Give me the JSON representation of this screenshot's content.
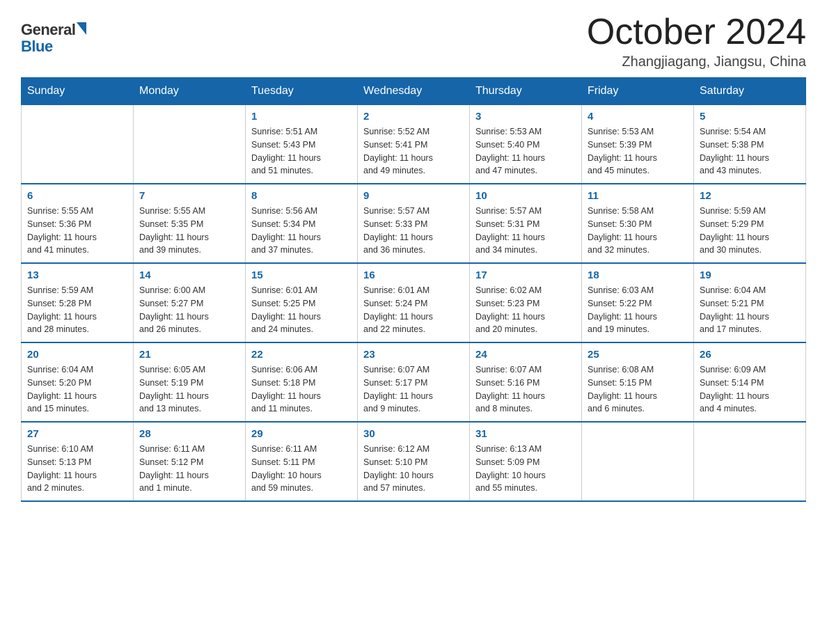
{
  "logo": {
    "general": "General",
    "blue": "Blue"
  },
  "title": {
    "month_year": "October 2024",
    "location": "Zhangjiagang, Jiangsu, China"
  },
  "weekdays": [
    "Sunday",
    "Monday",
    "Tuesday",
    "Wednesday",
    "Thursday",
    "Friday",
    "Saturday"
  ],
  "weeks": [
    [
      {
        "day": "",
        "info": ""
      },
      {
        "day": "",
        "info": ""
      },
      {
        "day": "1",
        "info": "Sunrise: 5:51 AM\nSunset: 5:43 PM\nDaylight: 11 hours\nand 51 minutes."
      },
      {
        "day": "2",
        "info": "Sunrise: 5:52 AM\nSunset: 5:41 PM\nDaylight: 11 hours\nand 49 minutes."
      },
      {
        "day": "3",
        "info": "Sunrise: 5:53 AM\nSunset: 5:40 PM\nDaylight: 11 hours\nand 47 minutes."
      },
      {
        "day": "4",
        "info": "Sunrise: 5:53 AM\nSunset: 5:39 PM\nDaylight: 11 hours\nand 45 minutes."
      },
      {
        "day": "5",
        "info": "Sunrise: 5:54 AM\nSunset: 5:38 PM\nDaylight: 11 hours\nand 43 minutes."
      }
    ],
    [
      {
        "day": "6",
        "info": "Sunrise: 5:55 AM\nSunset: 5:36 PM\nDaylight: 11 hours\nand 41 minutes."
      },
      {
        "day": "7",
        "info": "Sunrise: 5:55 AM\nSunset: 5:35 PM\nDaylight: 11 hours\nand 39 minutes."
      },
      {
        "day": "8",
        "info": "Sunrise: 5:56 AM\nSunset: 5:34 PM\nDaylight: 11 hours\nand 37 minutes."
      },
      {
        "day": "9",
        "info": "Sunrise: 5:57 AM\nSunset: 5:33 PM\nDaylight: 11 hours\nand 36 minutes."
      },
      {
        "day": "10",
        "info": "Sunrise: 5:57 AM\nSunset: 5:31 PM\nDaylight: 11 hours\nand 34 minutes."
      },
      {
        "day": "11",
        "info": "Sunrise: 5:58 AM\nSunset: 5:30 PM\nDaylight: 11 hours\nand 32 minutes."
      },
      {
        "day": "12",
        "info": "Sunrise: 5:59 AM\nSunset: 5:29 PM\nDaylight: 11 hours\nand 30 minutes."
      }
    ],
    [
      {
        "day": "13",
        "info": "Sunrise: 5:59 AM\nSunset: 5:28 PM\nDaylight: 11 hours\nand 28 minutes."
      },
      {
        "day": "14",
        "info": "Sunrise: 6:00 AM\nSunset: 5:27 PM\nDaylight: 11 hours\nand 26 minutes."
      },
      {
        "day": "15",
        "info": "Sunrise: 6:01 AM\nSunset: 5:25 PM\nDaylight: 11 hours\nand 24 minutes."
      },
      {
        "day": "16",
        "info": "Sunrise: 6:01 AM\nSunset: 5:24 PM\nDaylight: 11 hours\nand 22 minutes."
      },
      {
        "day": "17",
        "info": "Sunrise: 6:02 AM\nSunset: 5:23 PM\nDaylight: 11 hours\nand 20 minutes."
      },
      {
        "day": "18",
        "info": "Sunrise: 6:03 AM\nSunset: 5:22 PM\nDaylight: 11 hours\nand 19 minutes."
      },
      {
        "day": "19",
        "info": "Sunrise: 6:04 AM\nSunset: 5:21 PM\nDaylight: 11 hours\nand 17 minutes."
      }
    ],
    [
      {
        "day": "20",
        "info": "Sunrise: 6:04 AM\nSunset: 5:20 PM\nDaylight: 11 hours\nand 15 minutes."
      },
      {
        "day": "21",
        "info": "Sunrise: 6:05 AM\nSunset: 5:19 PM\nDaylight: 11 hours\nand 13 minutes."
      },
      {
        "day": "22",
        "info": "Sunrise: 6:06 AM\nSunset: 5:18 PM\nDaylight: 11 hours\nand 11 minutes."
      },
      {
        "day": "23",
        "info": "Sunrise: 6:07 AM\nSunset: 5:17 PM\nDaylight: 11 hours\nand 9 minutes."
      },
      {
        "day": "24",
        "info": "Sunrise: 6:07 AM\nSunset: 5:16 PM\nDaylight: 11 hours\nand 8 minutes."
      },
      {
        "day": "25",
        "info": "Sunrise: 6:08 AM\nSunset: 5:15 PM\nDaylight: 11 hours\nand 6 minutes."
      },
      {
        "day": "26",
        "info": "Sunrise: 6:09 AM\nSunset: 5:14 PM\nDaylight: 11 hours\nand 4 minutes."
      }
    ],
    [
      {
        "day": "27",
        "info": "Sunrise: 6:10 AM\nSunset: 5:13 PM\nDaylight: 11 hours\nand 2 minutes."
      },
      {
        "day": "28",
        "info": "Sunrise: 6:11 AM\nSunset: 5:12 PM\nDaylight: 11 hours\nand 1 minute."
      },
      {
        "day": "29",
        "info": "Sunrise: 6:11 AM\nSunset: 5:11 PM\nDaylight: 10 hours\nand 59 minutes."
      },
      {
        "day": "30",
        "info": "Sunrise: 6:12 AM\nSunset: 5:10 PM\nDaylight: 10 hours\nand 57 minutes."
      },
      {
        "day": "31",
        "info": "Sunrise: 6:13 AM\nSunset: 5:09 PM\nDaylight: 10 hours\nand 55 minutes."
      },
      {
        "day": "",
        "info": ""
      },
      {
        "day": "",
        "info": ""
      }
    ]
  ]
}
